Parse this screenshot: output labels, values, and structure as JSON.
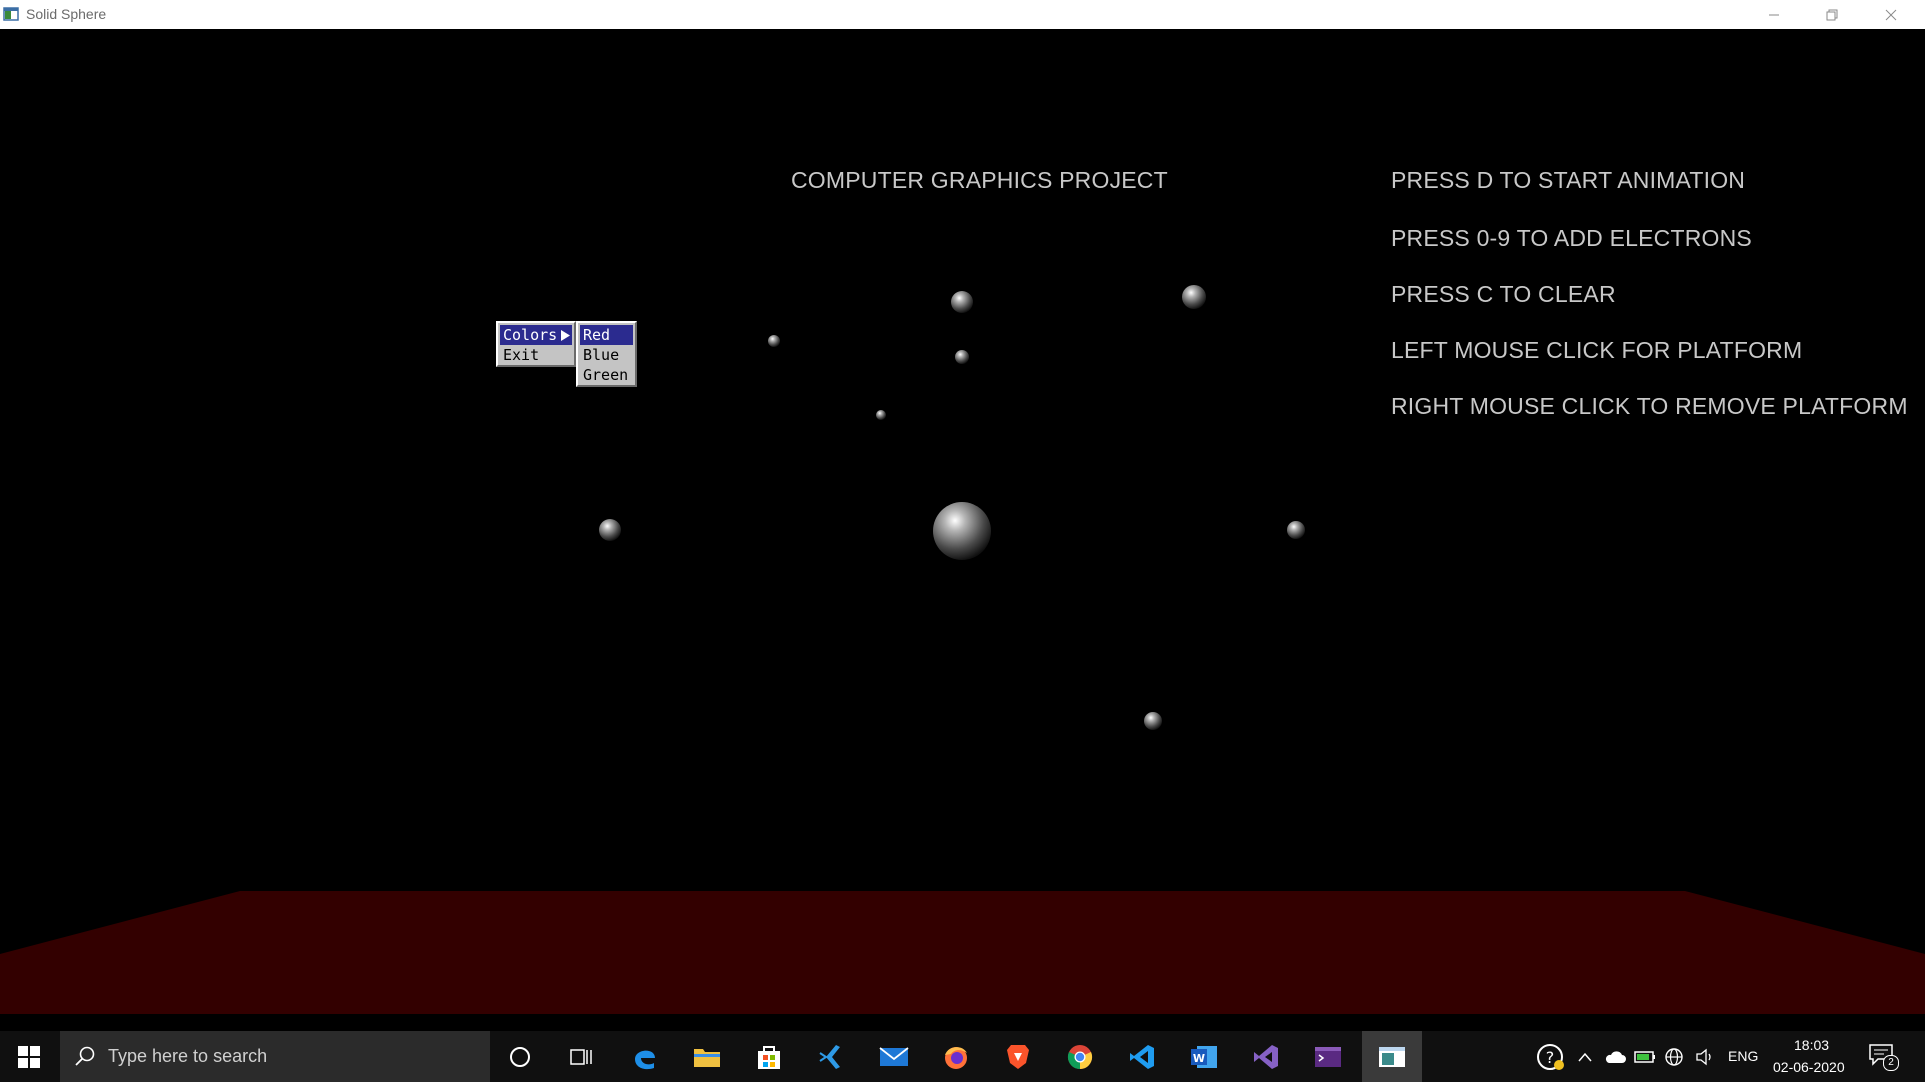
{
  "window": {
    "title": "Solid Sphere"
  },
  "scene": {
    "heading": "COMPUTER GRAPHICS PROJECT",
    "instructions": [
      "PRESS D TO START ANIMATION",
      "PRESS 0-9 TO ADD ELECTRONS",
      "PRESS C TO CLEAR",
      "LEFT MOUSE CLICK FOR PLATFORM",
      "RIGHT MOUSE CLICK TO REMOVE PLATFORM"
    ],
    "platform_color": "#330000",
    "sphere_color": "#b8b8b8"
  },
  "context_menu": {
    "items": [
      "Colors",
      "Exit"
    ],
    "highlighted": "Colors",
    "submenu": {
      "items": [
        "Red",
        "Blue",
        "Green"
      ],
      "highlighted": "Red"
    },
    "highlight_color": "#2b2b8f"
  },
  "taskbar": {
    "search_placeholder": "Type here to search",
    "pinned_apps": [
      "cortana-icon",
      "task-view-icon",
      "edge-icon",
      "file-explorer-icon",
      "store-icon",
      "vs-code-insiders-icon",
      "mail-icon",
      "firefox-icon",
      "brave-icon",
      "chrome-icon",
      "vs-code-icon",
      "word-icon",
      "visual-studio-icon",
      "terminal-icon",
      "solid-sphere-app-icon"
    ],
    "language": "ENG",
    "time": "18:03",
    "date": "02-06-2020",
    "notification_count": "2"
  }
}
